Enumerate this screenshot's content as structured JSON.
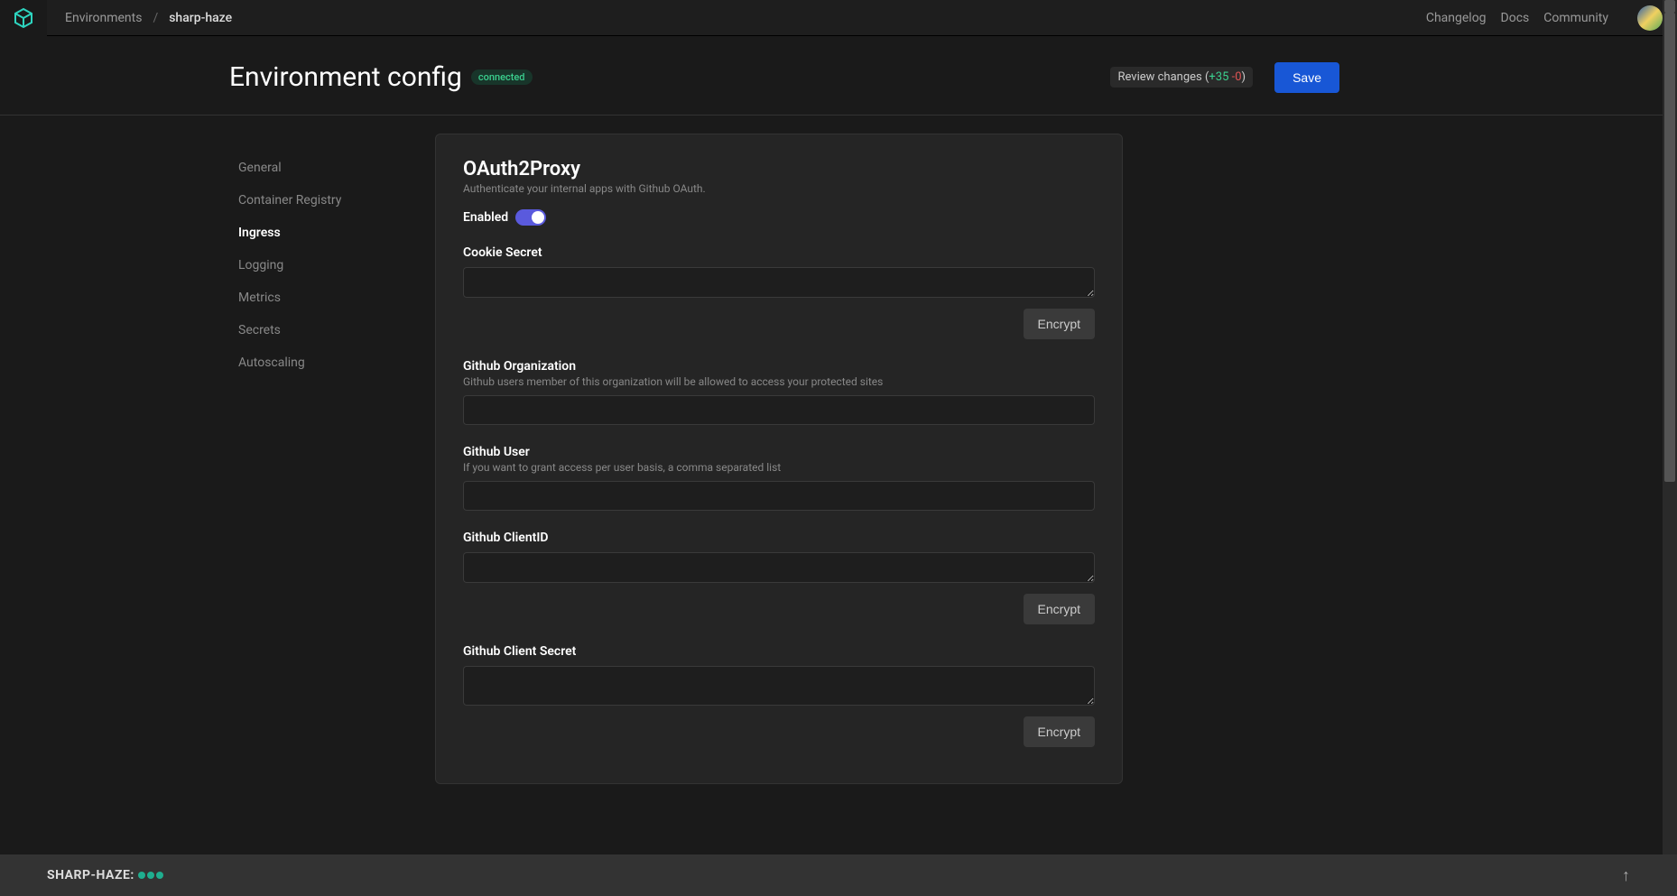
{
  "breadcrumb": {
    "root": "Environments",
    "current": "sharp-haze"
  },
  "topnav": {
    "changelog": "Changelog",
    "docs": "Docs",
    "community": "Community"
  },
  "header": {
    "title": "Environment config",
    "badge": "connected",
    "review_prefix": "Review changes (",
    "review_plus": "+35",
    "review_minus": " -0",
    "review_suffix": ")",
    "save": "Save"
  },
  "sidebar": {
    "items": [
      "General",
      "Container Registry",
      "Ingress",
      "Logging",
      "Metrics",
      "Secrets",
      "Autoscaling"
    ],
    "active_index": 2
  },
  "panel": {
    "title": "OAuth2Proxy",
    "subtitle": "Authenticate your internal apps with Github OAuth.",
    "enabled_label": "Enabled",
    "enabled": true,
    "encrypt_label": "Encrypt",
    "fields": {
      "cookie_secret": {
        "label": "Cookie Secret",
        "value": "",
        "encrypt": true
      },
      "github_org": {
        "label": "Github Organization",
        "help": "Github users member of this organization will be allowed to access your protected sites",
        "value": ""
      },
      "github_user": {
        "label": "Github User",
        "help": "If you want to grant access per user basis, a comma separated list",
        "value": ""
      },
      "github_clientid": {
        "label": "Github ClientID",
        "value": "",
        "encrypt": true
      },
      "github_client_secret": {
        "label": "Github Client Secret",
        "value": "",
        "encrypt": true
      }
    }
  },
  "statusbar": {
    "name": "SHARP-HAZE:"
  }
}
